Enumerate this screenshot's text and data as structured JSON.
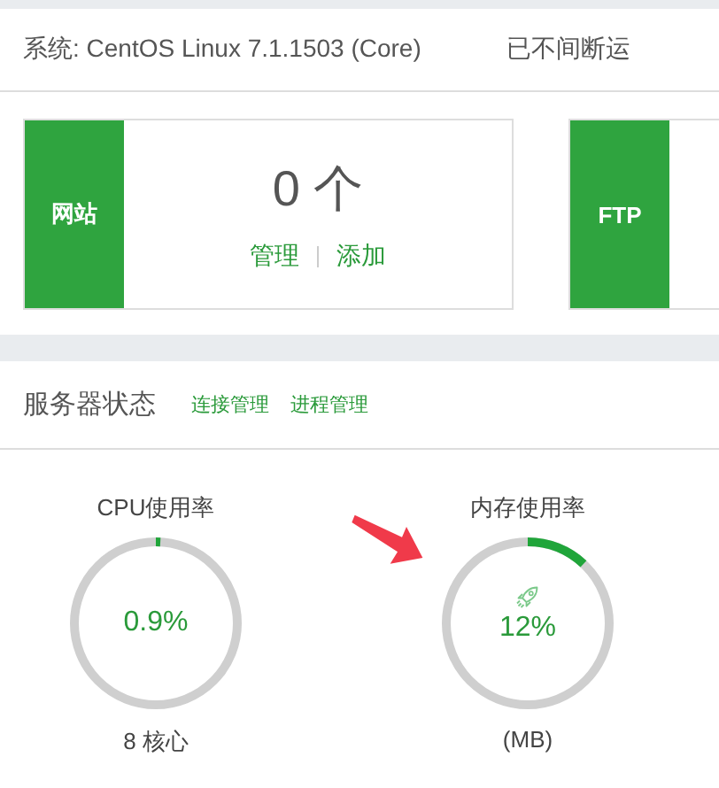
{
  "system": {
    "label": "系统: CentOS Linux 7.1.1503 (Core)",
    "uptime": "已不间断运"
  },
  "cards": [
    {
      "name": "网站",
      "count": "0 个",
      "links": [
        "管理",
        "添加"
      ]
    },
    {
      "name": "FTP"
    }
  ],
  "server_status": {
    "title": "服务器状态",
    "links": [
      "连接管理",
      "进程管理"
    ]
  },
  "gauges": [
    {
      "title": "CPU使用率",
      "value": "0.9%",
      "level": 0.009,
      "caption": "8 核心",
      "kind": "plain"
    },
    {
      "title": "内存使用率",
      "value": "12%",
      "level": 0.12,
      "caption": "(MB)",
      "kind": "badged"
    }
  ]
}
